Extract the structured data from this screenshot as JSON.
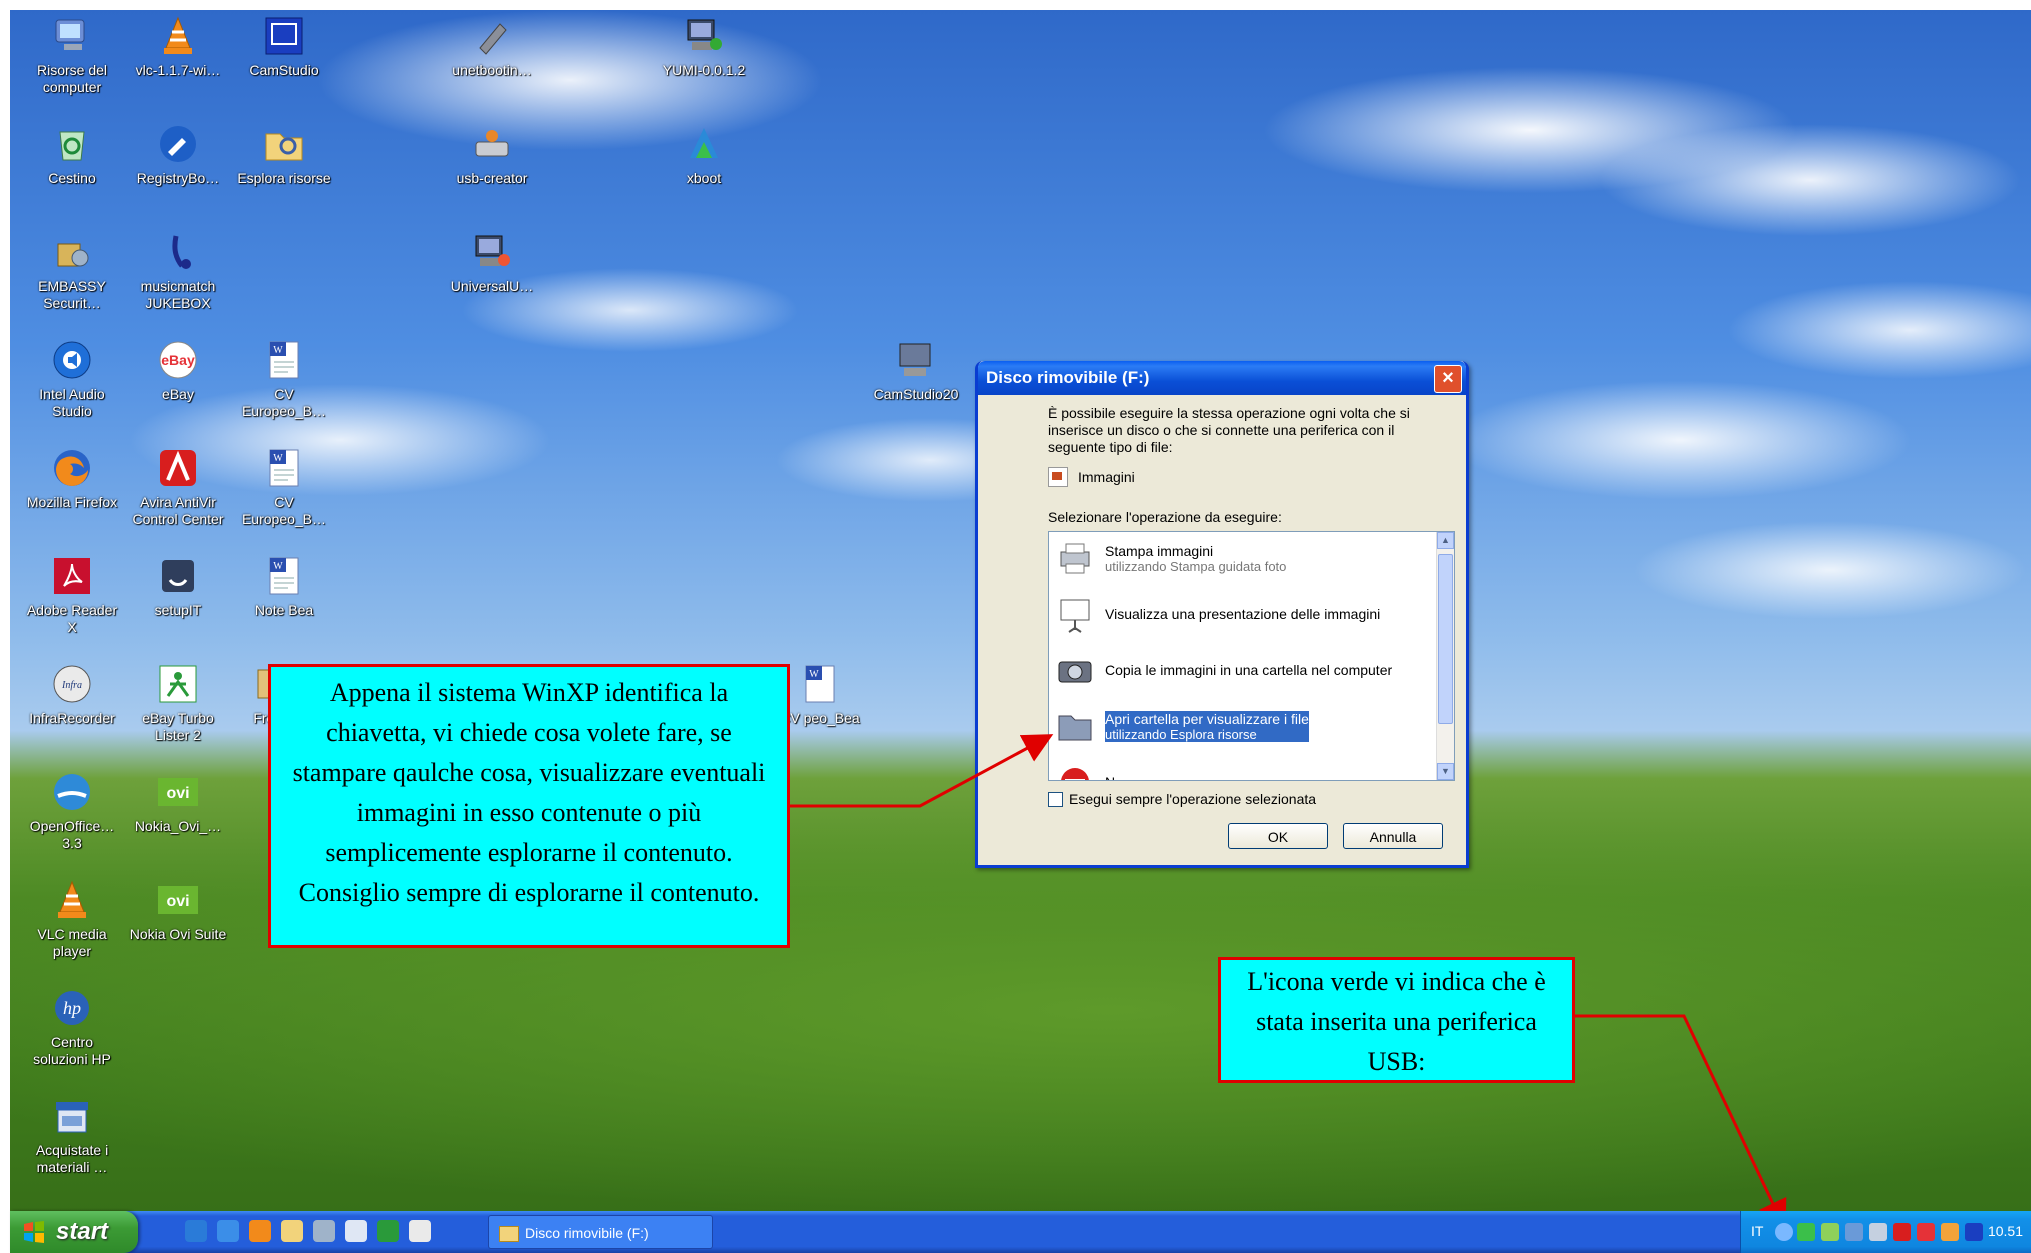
{
  "desktop_icons": [
    {
      "label": "Risorse del computer",
      "icon": "my-computer-icon"
    },
    {
      "label": "vlc-1.1.7-wi…",
      "icon": "vlc-icon"
    },
    {
      "label": "CamStudio",
      "icon": "camstudio-icon"
    },
    {
      "label": "unetbootin…",
      "icon": "unetbootin-icon"
    },
    {
      "label": "YUMI-0.0.1.2",
      "icon": "yumi-icon"
    },
    {
      "label": "Cestino",
      "icon": "recycle-bin-icon"
    },
    {
      "label": "RegistryBo…",
      "icon": "registry-booster-icon"
    },
    {
      "label": "Esplora risorse",
      "icon": "explorer-icon"
    },
    {
      "label": "usb-creator",
      "icon": "usb-creator-icon"
    },
    {
      "label": "xboot",
      "icon": "xboot-icon"
    },
    {
      "label": "EMBASSY Securit…",
      "icon": "embassy-security-icon"
    },
    {
      "label": "musicmatch JUKEBOX",
      "icon": "musicmatch-icon"
    },
    {
      "label": "UniversalU…",
      "icon": "universal-usb-icon"
    },
    {
      "label": "Intel Audio Studio",
      "icon": "intel-audio-icon"
    },
    {
      "label": "eBay",
      "icon": "ebay-icon"
    },
    {
      "label": "CV Europeo_B…",
      "icon": "word-doc-icon"
    },
    {
      "label": "CamStudio20",
      "icon": "camstudio20-icon"
    },
    {
      "label": "Mozilla Firefox",
      "icon": "firefox-icon"
    },
    {
      "label": "Avira AntiVir Control Center",
      "icon": "avira-icon"
    },
    {
      "label": "CV Europeo_B…",
      "icon": "word-doc-icon"
    },
    {
      "label": "Adobe Reader X",
      "icon": "adobe-reader-icon"
    },
    {
      "label": "setupIT",
      "icon": "setupit-icon"
    },
    {
      "label": "Note Bea",
      "icon": "word-doc-icon"
    },
    {
      "label": "InfraRecorder",
      "icon": "infrarecorder-icon"
    },
    {
      "label": "eBay Turbo Lister 2",
      "icon": "ebay-turbo-lister-icon"
    },
    {
      "label": "FreeF",
      "icon": "freef-icon"
    },
    {
      "label": "CV peo_Bea",
      "icon": "word-doc-icon"
    },
    {
      "label": "OpenOffice… 3.3",
      "icon": "openoffice-icon"
    },
    {
      "label": "Nokia_Ovi_…",
      "icon": "ovi-icon"
    },
    {
      "label": "VLC media player",
      "icon": "vlc-icon"
    },
    {
      "label": "Nokia Ovi Suite",
      "icon": "ovi-icon"
    },
    {
      "label": "Centro soluzioni HP",
      "icon": "hp-icon"
    },
    {
      "label": "Acquistate i materiali …",
      "icon": "shop-icon"
    }
  ],
  "dialog": {
    "title": "Disco rimovibile (F:)",
    "close_label": "×",
    "intro": "È possibile eseguire la stessa operazione ogni volta che si inserisce un disco o che si connette una periferica con il seguente tipo di file:",
    "file_type": "Immagini",
    "select_label": "Selezionare l'operazione da eseguire:",
    "actions": [
      {
        "title": "Stampa immagini",
        "subtitle": "utilizzando Stampa guidata foto",
        "icon": "printer-icon"
      },
      {
        "title": "Visualizza una presentazione delle immagini",
        "subtitle": "",
        "icon": "slideshow-icon"
      },
      {
        "title": "Copia le immagini in una cartella nel computer",
        "subtitle": "",
        "icon": "camera-icon"
      },
      {
        "title": "Apri cartella per visualizzare i file",
        "subtitle": "utilizzando Esplora risorse",
        "icon": "folder-icon",
        "selected": true
      },
      {
        "title": "N",
        "subtitle": "",
        "icon": "no-action-icon"
      }
    ],
    "always_label": "Esegui sempre l'operazione selezionata",
    "ok_label": "OK",
    "cancel_label": "Annulla"
  },
  "callouts": {
    "main": "Appena il sistema WinXP identifica la chiavetta, vi chiede cosa volete fare, se stampare qaulche cosa, visualizzare eventuali immagini in esso contenute o più semplicemente esplorarne il contenuto. Consiglio sempre di esplorarne il contenuto.",
    "tray": "L'icona verde vi indica che è stata inserita una periferica USB:"
  },
  "taskbar": {
    "start_label": "start",
    "task_item": "Disco rimovibile (F:)",
    "lang": "IT",
    "clock": "10.51"
  },
  "colors": {
    "callout_fill": "#00ffff",
    "callout_border": "#e00000",
    "xp_blue": "#245edb",
    "start_green": "#3c9b35"
  }
}
